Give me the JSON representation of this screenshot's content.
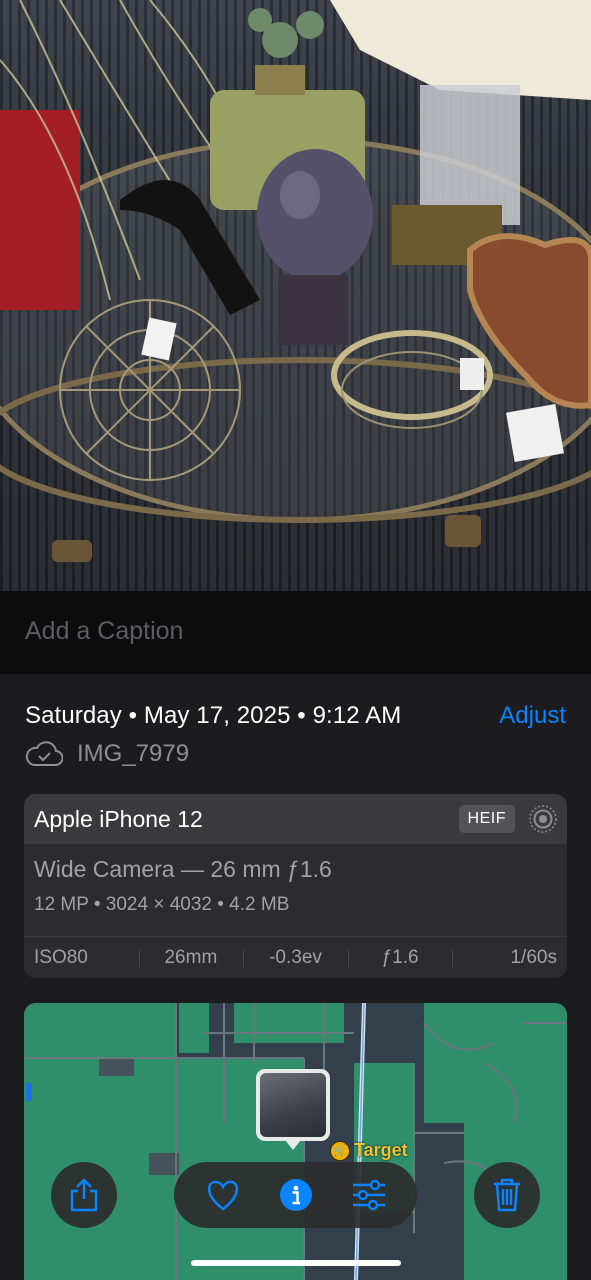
{
  "caption": {
    "placeholder": "Add a Caption"
  },
  "info": {
    "date_line": "Saturday • May 17, 2025 • 9:12 AM",
    "adjust_label": "Adjust",
    "filename": "IMG_7979"
  },
  "camera": {
    "model": "Apple iPhone 12",
    "format_badge": "HEIF",
    "lens": "Wide Camera — 26 mm ƒ1.6",
    "specs": "12 MP • 3024 × 4032 • 4.2 MB",
    "exif": [
      "ISO80",
      "26mm",
      "-0.3ev",
      "ƒ1.6",
      "1/60s"
    ]
  },
  "map": {
    "poi_label": "Target"
  },
  "toolbar": {
    "icons": [
      "share-icon",
      "heart-icon",
      "info-icon",
      "adjust-sliders-icon",
      "trash-icon"
    ]
  },
  "colors": {
    "accent": "#0a84ff",
    "sheet_bg": "#1c1c1e",
    "card_bg": "#2c2c2e",
    "map_green": "#2f8f6b"
  }
}
